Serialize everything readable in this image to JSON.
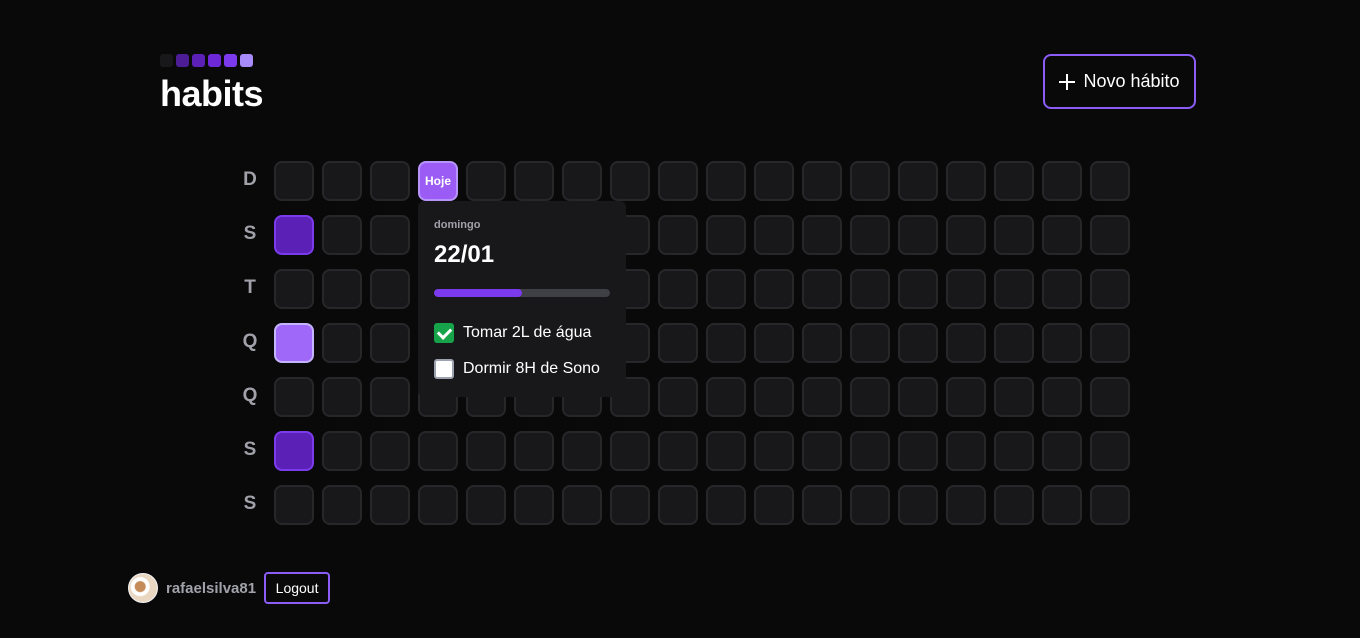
{
  "app": {
    "title": "habits",
    "logo_colors": [
      "#18181b",
      "#4c1d95",
      "#5b21b6",
      "#6d28d9",
      "#7c3aed",
      "#a78bfa"
    ]
  },
  "header": {
    "new_habit_label": "Novo hábito",
    "new_habit_icon": "plus-icon"
  },
  "calendar": {
    "weekdays": [
      "D",
      "S",
      "T",
      "Q",
      "Q",
      "S",
      "S"
    ],
    "today_label": "Hoje",
    "columns": 18,
    "completed_cells": [
      {
        "weekday_index": 1,
        "column": 0,
        "level": "l1"
      },
      {
        "weekday_index": 3,
        "column": 0,
        "level": "l4"
      },
      {
        "weekday_index": 5,
        "column": 0,
        "level": "l1"
      }
    ]
  },
  "popover": {
    "weekday": "domingo",
    "date": "22/01",
    "progress_percent": 50,
    "habits": [
      {
        "label": "Tomar 2L de água",
        "checked": true
      },
      {
        "label": "Dormir 8H de Sono",
        "checked": false
      }
    ]
  },
  "user": {
    "username": "rafaelsilva81",
    "logout_label": "Logout"
  },
  "colors": {
    "accent": "#8b5cf6",
    "today": "#9b5cf6",
    "check_green": "#16a34a"
  }
}
